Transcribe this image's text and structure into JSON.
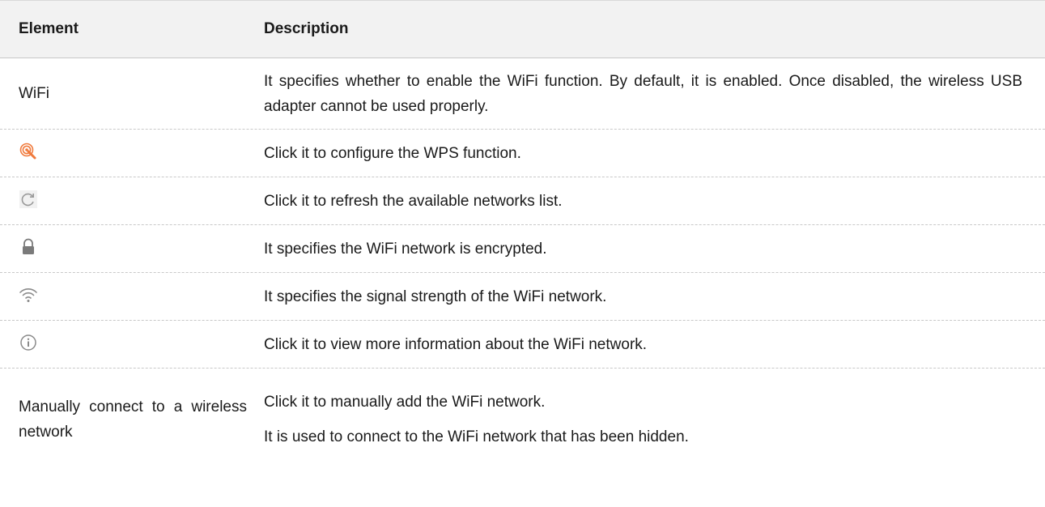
{
  "table": {
    "header": {
      "element": "Element",
      "description": "Description"
    },
    "rows": [
      {
        "element": "WiFi",
        "description": "It specifies whether to enable the WiFi function. By default, it is enabled. Once disabled, the wireless USB adapter cannot be used properly."
      },
      {
        "element_icon": "wps-icon",
        "description": "Click it to configure the WPS function."
      },
      {
        "element_icon": "refresh-icon",
        "description": "Click it to refresh the available networks list."
      },
      {
        "element_icon": "lock-icon",
        "description": "It specifies the WiFi network is encrypted."
      },
      {
        "element_icon": "wifi-signal-icon",
        "description": "It specifies the signal strength of the WiFi network."
      },
      {
        "element_icon": "info-icon",
        "description": "Click it to view more information about the WiFi network."
      },
      {
        "element": "Manually connect to a wireless network",
        "description_lines": [
          "Click it to manually add the WiFi network.",
          "It is used to connect to the WiFi network that has been hidden."
        ]
      }
    ]
  },
  "colors": {
    "header_bg": "#f2f2f2",
    "wps_icon": "#f07a3c",
    "icon_gray": "#9a9a9a"
  }
}
